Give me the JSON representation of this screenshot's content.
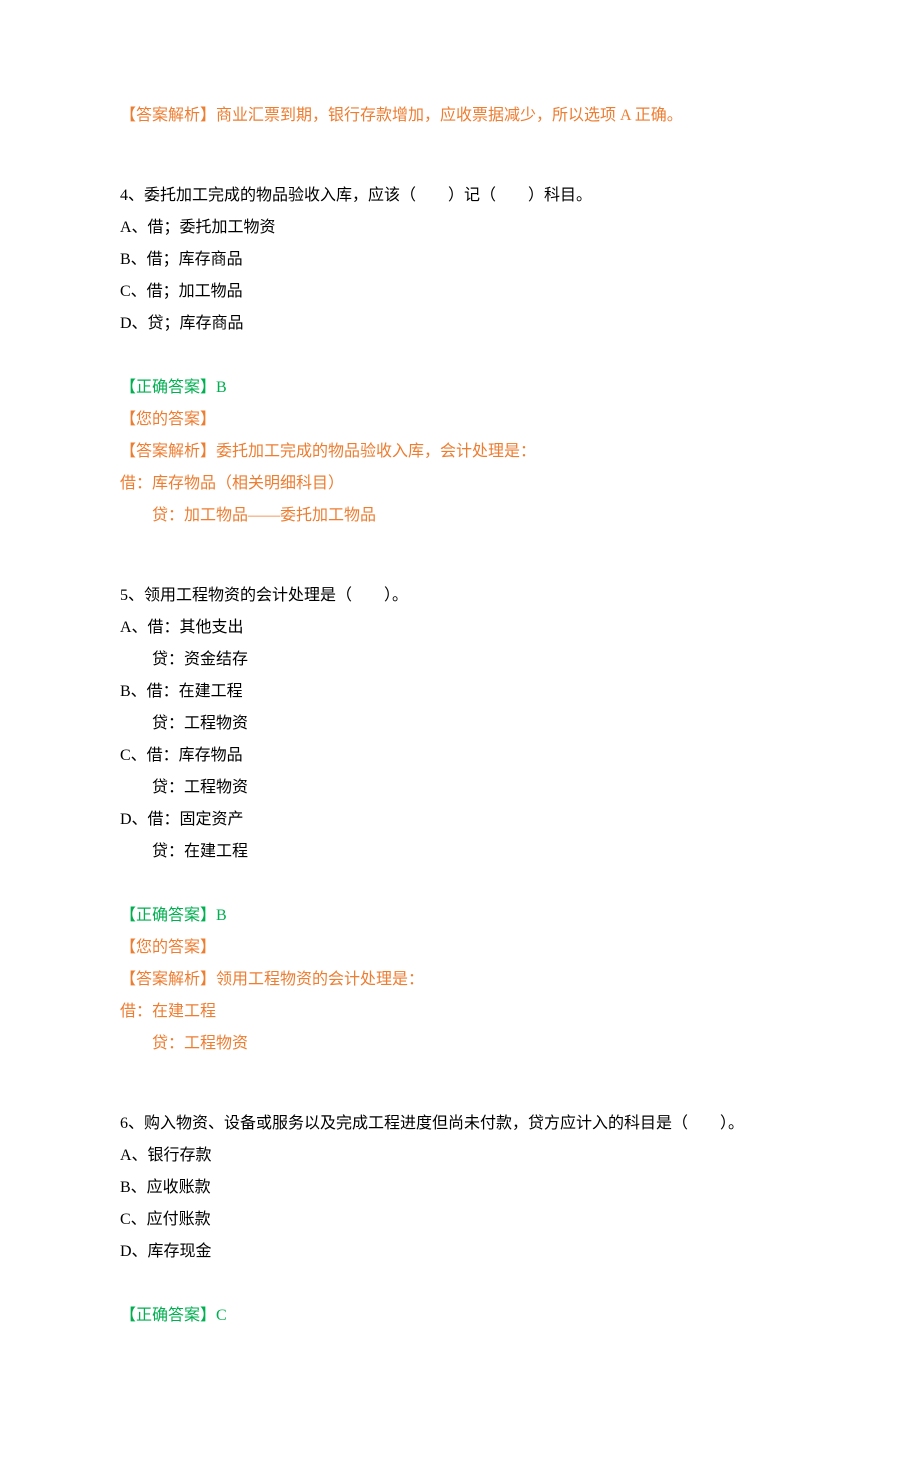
{
  "q3": {
    "expl_label": "【答案解析】",
    "expl_text": "商业汇票到期，银行存款增加，应收票据减少，所以选项 A 正确。"
  },
  "q4": {
    "stem": "4、委托加工完成的物品验收入库，应该（　　）记（　　）科目。",
    "optA": "A、借；委托加工物资",
    "optB": "B、借；库存商品",
    "optC": "C、借；加工物品",
    "optD": "D、贷；库存商品",
    "correct_label": "【正确答案】",
    "correct_value": "B",
    "your_label": "【您的答案】",
    "expl_label": "【答案解析】",
    "expl_text": "委托加工完成的物品验收入库，会计处理是：",
    "expl_line1": "借：库存物品（相关明细科目）",
    "expl_line2": "贷：加工物品——委托加工物品"
  },
  "q5": {
    "stem": "5、领用工程物资的会计处理是（　　）。",
    "optA1": "A、借：其他支出",
    "optA2": "贷：资金结存",
    "optB1": "B、借：在建工程",
    "optB2": "贷：工程物资",
    "optC1": "C、借：库存物品",
    "optC2": "贷：工程物资",
    "optD1": "D、借：固定资产",
    "optD2": "贷：在建工程",
    "correct_label": "【正确答案】",
    "correct_value": "B",
    "your_label": "【您的答案】",
    "expl_label": "【答案解析】",
    "expl_text": "领用工程物资的会计处理是：",
    "expl_line1": "借：在建工程",
    "expl_line2": "贷：工程物资"
  },
  "q6": {
    "stem": "6、购入物资、设备或服务以及完成工程进度但尚未付款，贷方应计入的科目是（　　）。",
    "optA": "A、银行存款",
    "optB": "B、应收账款",
    "optC": "C、应付账款",
    "optD": "D、库存现金",
    "correct_label": "【正确答案】",
    "correct_value": "C"
  }
}
